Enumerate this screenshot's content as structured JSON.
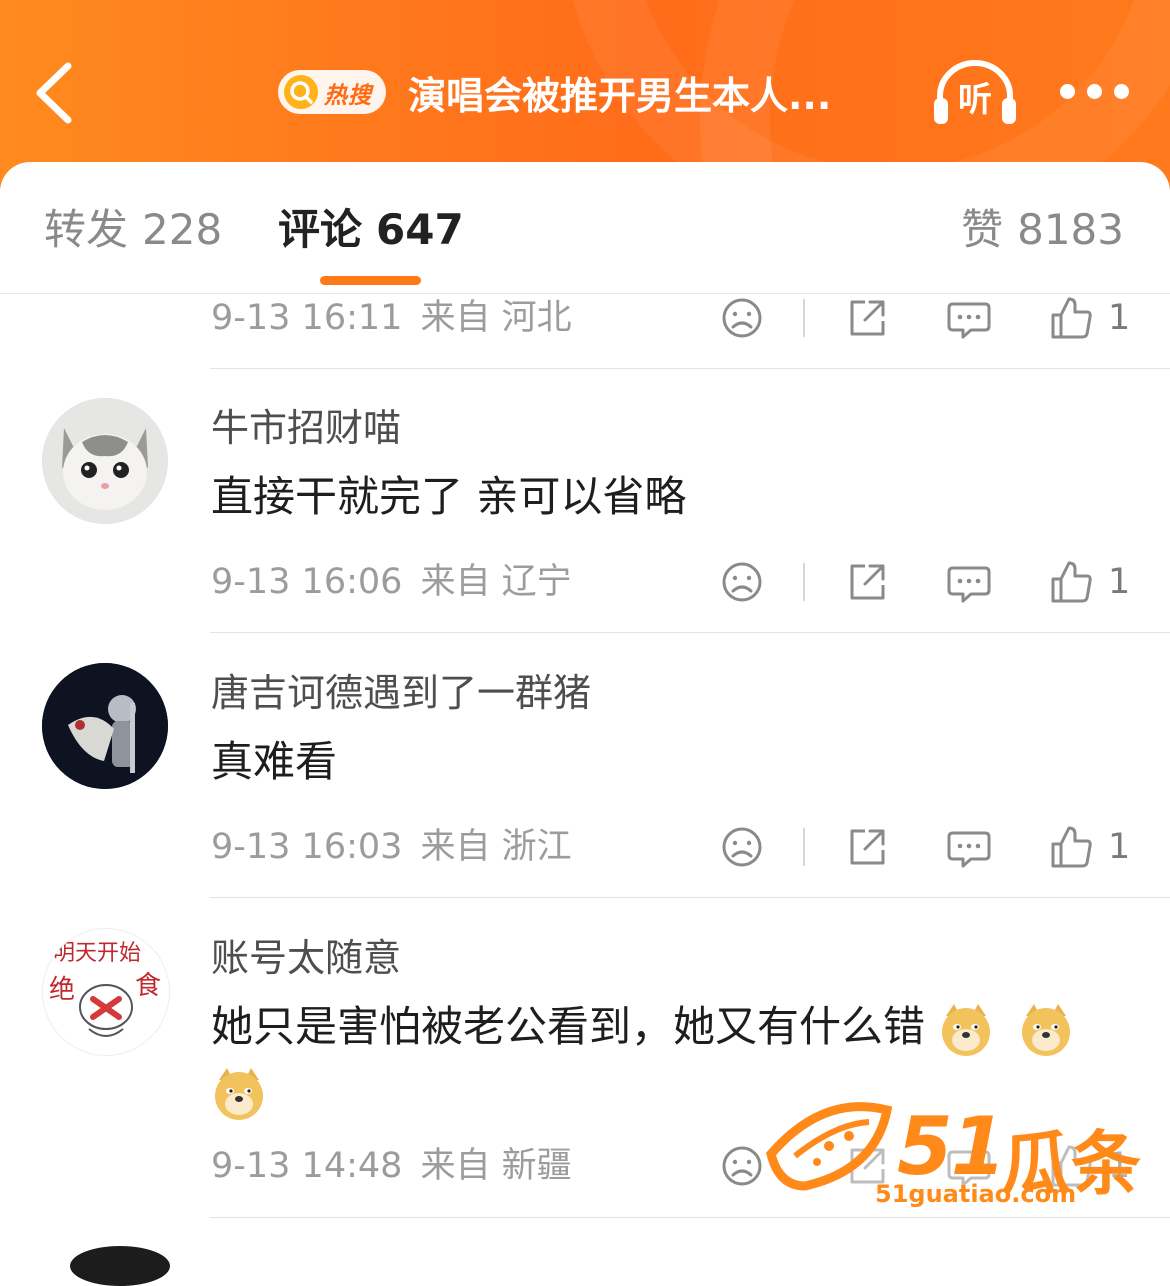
{
  "header": {
    "hot_badge": "热搜",
    "topic_title": "演唱会被推开男生本人...",
    "listen_label": "听"
  },
  "tabs": {
    "repost_label": "转发",
    "repost_count": "228",
    "comment_label": "评论",
    "comment_count": "647",
    "likes_label": "赞",
    "likes_count": "8183"
  },
  "comments": [
    {
      "time": "9-13 16:11",
      "location": "来自 河北",
      "like_count": "1"
    },
    {
      "username": "牛市招财喵",
      "text": "直接干就完了 亲可以省略",
      "time": "9-13 16:06",
      "location": "来自 辽宁",
      "like_count": "1"
    },
    {
      "username": "唐吉诃德遇到了一群猪",
      "text": "真难看",
      "time": "9-13 16:03",
      "location": "来自 浙江",
      "like_count": "1"
    },
    {
      "username": "账号太随意",
      "text": "她只是害怕被老公看到，她又有什么错",
      "time": "9-13 14:48",
      "location": "来自 新疆",
      "like_count": "1",
      "avatar_text_top": "明天开始",
      "avatar_text_left": "绝",
      "avatar_text_right": "食"
    }
  ],
  "watermark": {
    "num": "51",
    "name": "瓜条",
    "url": "51guatiao.com"
  },
  "colors": {
    "accent": "#ff7a16",
    "header_bg": "#ff7a1c",
    "muted_text": "#9c9c9c"
  },
  "icons": [
    "back-arrow-icon",
    "search-icon",
    "headphones-icon",
    "more-dots-icon",
    "sad-face-icon",
    "share-icon",
    "comment-bubble-icon",
    "thumbs-up-icon",
    "doge-emoji-icon"
  ]
}
